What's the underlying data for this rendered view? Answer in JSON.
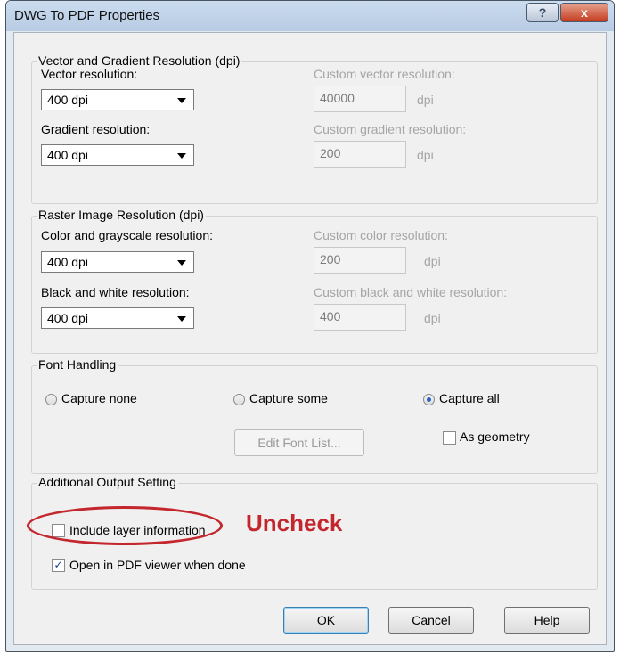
{
  "window": {
    "title": "DWG To PDF Properties",
    "help_glyph": "?",
    "close_glyph": "x"
  },
  "vector_group": {
    "title": "Vector and Gradient Resolution (dpi)",
    "vector_label": "Vector resolution:",
    "vector_value": "400 dpi",
    "gradient_label": "Gradient resolution:",
    "gradient_value": "400 dpi",
    "custom_vector_label": "Custom vector resolution:",
    "custom_vector_value": "40000",
    "custom_gradient_label": "Custom gradient resolution:",
    "custom_gradient_value": "200",
    "unit": "dpi"
  },
  "raster_group": {
    "title": "Raster Image Resolution (dpi)",
    "color_label": "Color and grayscale resolution:",
    "color_value": "400 dpi",
    "bw_label": "Black and white resolution:",
    "bw_value": "400 dpi",
    "custom_color_label": "Custom color resolution:",
    "custom_color_value": "200",
    "custom_bw_label": "Custom black and white resolution:",
    "custom_bw_value": "400",
    "unit": "dpi"
  },
  "font_group": {
    "title": "Font Handling",
    "capture_none": "Capture none",
    "capture_some": "Capture some",
    "capture_all": "Capture all",
    "selected": "Capture all",
    "edit_font_list": "Edit Font List...",
    "as_geometry": "As geometry",
    "as_geometry_checked": false
  },
  "output_group": {
    "title": "Additional Output Setting",
    "include_layer": "Include layer information",
    "include_layer_checked": false,
    "open_pdf": "Open in PDF viewer when done",
    "open_pdf_checked": true
  },
  "annotation": {
    "text": "Uncheck",
    "color": "#c4262e"
  },
  "buttons": {
    "ok": "OK",
    "cancel": "Cancel",
    "help": "Help"
  }
}
